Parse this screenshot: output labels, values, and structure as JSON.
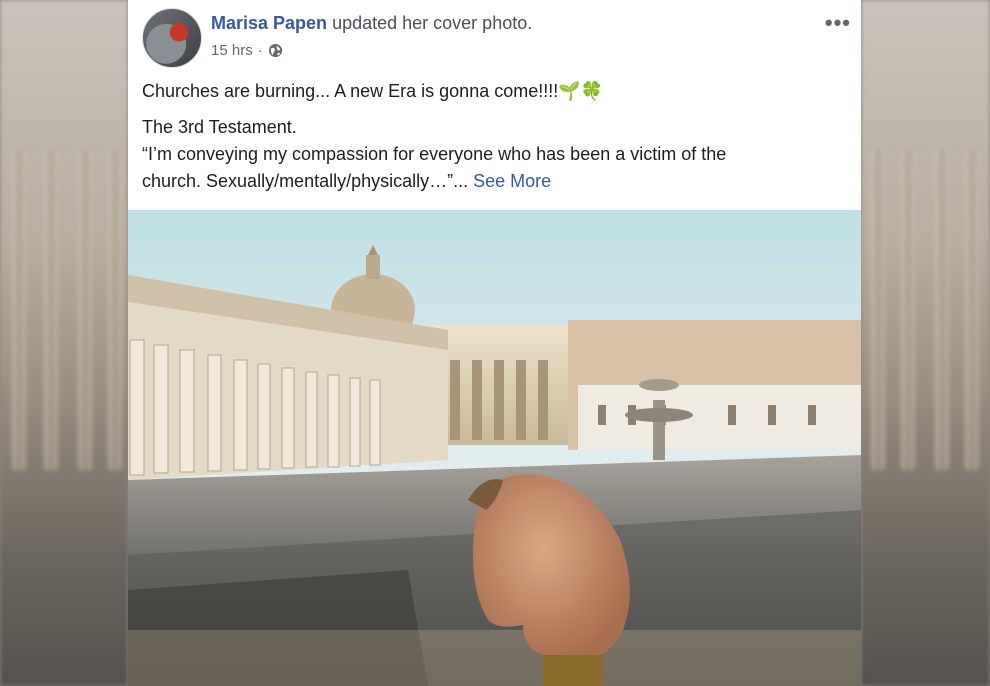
{
  "post": {
    "author": "Marisa Papen",
    "action": "updated her cover photo.",
    "time": "15 hrs",
    "separator": "·",
    "privacy_icon": "globe-icon",
    "more_icon": "more-options-icon",
    "more_glyph": "•••",
    "line1": "Churches are burning... A new Era is gonna come!!!!",
    "line1_emojis": "🌱🍀",
    "line2": "The 3rd Testament.",
    "line3": "“I’m conveying my compassion for everyone who has been a victim of the",
    "line4": "church. Sexually/mentally/physically…”...",
    "see_more": "See More"
  },
  "colors": {
    "link": "#385898",
    "text": "#1c1e21",
    "meta": "#616770"
  }
}
